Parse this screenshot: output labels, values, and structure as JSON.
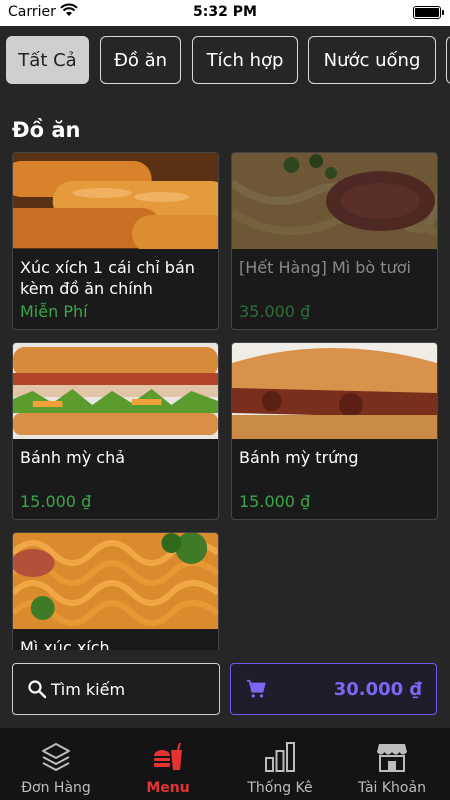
{
  "status_bar": {
    "carrier": "Carrier",
    "time": "5:32 PM"
  },
  "tabs": [
    {
      "label": "Tất Cả",
      "active": true
    },
    {
      "label": "Đồ ăn",
      "active": false
    },
    {
      "label": "Tích hợp",
      "active": false
    },
    {
      "label": "Nước uống",
      "active": false
    }
  ],
  "section_title": "Đồ ăn",
  "products": [
    {
      "name": "Xúc xích 1 cái chỉ bán kèm đồ ăn chính",
      "price": "Miễn Phí",
      "image": "sausage-image"
    },
    {
      "name": "[Hết Hàng] Mì bò tươi",
      "price": "35.000 ₫",
      "image": "beef-noodle-image"
    },
    {
      "name": "Bánh mỳ chả",
      "price": "15.000 ₫",
      "image": "banh-mi-cha-image"
    },
    {
      "name": "Bánh mỳ trứng",
      "price": "15.000 ₫",
      "image": "banh-mi-trung-image"
    },
    {
      "name": "Mì xúc xích",
      "price": "",
      "image": "sausage-noodle-image"
    }
  ],
  "search": {
    "placeholder": "Tìm kiếm"
  },
  "cart": {
    "total": "30.000 ₫",
    "accent_color": "#7a68f2"
  },
  "bottom_nav": [
    {
      "label": "Đơn Hàng",
      "icon": "layers-icon",
      "active": false
    },
    {
      "label": "Menu",
      "icon": "food-menu-icon",
      "active": true
    },
    {
      "label": "Thống Kê",
      "icon": "bar-chart-icon",
      "active": false
    },
    {
      "label": "Tài Khoản",
      "icon": "store-icon",
      "active": false
    }
  ],
  "colors": {
    "price_green": "#3aa64b",
    "active_nav": "#e53333",
    "cart_accent": "#6d5ce8"
  }
}
